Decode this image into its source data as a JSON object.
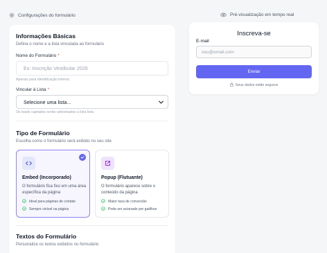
{
  "header": {
    "left_label": "Configurações do formulário",
    "left_icon": "gear-icon",
    "right_label": "Pré-visualização em tempo real",
    "right_icon": "eye-icon"
  },
  "basic_info": {
    "title": "Informações Básicas",
    "description": "Defina o nome e a lista vinculada ao formulário",
    "name_field": {
      "label": "Nome do Formulário",
      "required_mark": "*",
      "placeholder": "Ex: Inscrição Vestibular 2026",
      "value": "",
      "hint": "Apenas para identificação interna"
    },
    "list_field": {
      "label": "Vincular à Lista",
      "required_mark": "*",
      "selected": "Selecione uma lista...",
      "hint": "Os leads captados serão adicionados a lista lista"
    }
  },
  "form_type": {
    "title": "Tipo de Formulário",
    "description": "Escolha como o formulário será exibido no seu site",
    "options": [
      {
        "title": "Embed (Incorporado)",
        "icon": "code-icon",
        "description": "O formulário fica fixo em uma área específica da página",
        "features": [
          "Ideal para páginas de contato",
          "Sempre visível na página"
        ],
        "selected": true
      },
      {
        "title": "Popup (Flutuante)",
        "icon": "external-link-icon",
        "description": "O formulário aparece sobre o conteúdo da página",
        "features": [
          "Maior taxa de conversão",
          "Pode ser acionado por gatilhos"
        ],
        "selected": false
      }
    ]
  },
  "form_texts": {
    "title": "Textos do Formulário",
    "description": "Personalize os textos exibidos no formulário"
  },
  "preview": {
    "title": "Inscreva-se",
    "email_label": "E-mail",
    "email_placeholder": "seu@email.com",
    "submit_label": "Enviar",
    "security_note": "Seus dados estão seguros"
  },
  "colors": {
    "accent": "#6366f1",
    "success": "#22c55e",
    "required": "#ef4444",
    "background": "#f5f6f8"
  }
}
